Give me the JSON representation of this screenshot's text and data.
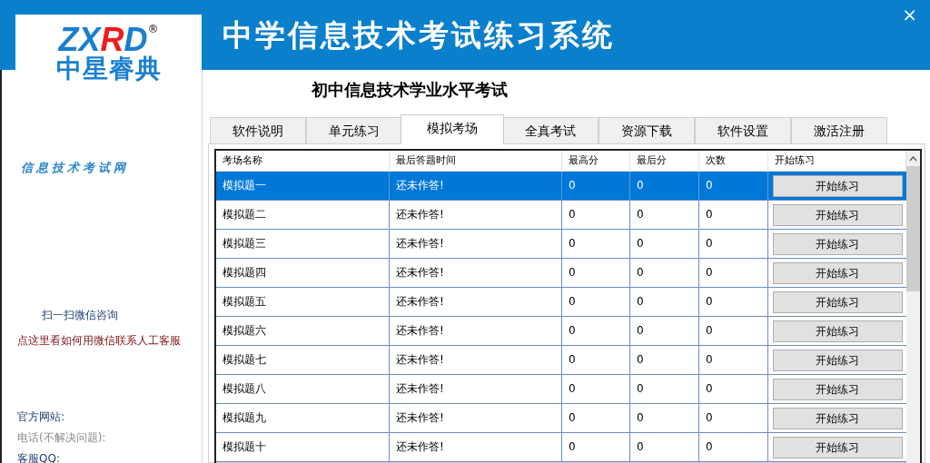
{
  "window": {
    "title": "中学信息技术考试练习系统",
    "close": "×"
  },
  "logo": {
    "letters": [
      {
        "text": "ZX",
        "color": "#1a7fcf"
      },
      {
        "text": "R",
        "color": "#f01c1c"
      },
      {
        "text": "D",
        "color": "#1a7fcf"
      }
    ],
    "mark": "®",
    "name": "中星睿典"
  },
  "sidebar": {
    "site_banner": "信息技术考试网",
    "wechat_hint": "扫一扫微信咨询",
    "wechat_link": "点这里看如何用微信联系人工客服",
    "contacts": [
      {
        "label": "官方网站:",
        "muted": false
      },
      {
        "label": "电话(不解决问题):",
        "muted": true
      },
      {
        "label": "客服QQ:",
        "muted": false
      }
    ]
  },
  "subtitle": "初中信息技术学业水平考试",
  "tabs": [
    {
      "label": "软件说明",
      "selected": false
    },
    {
      "label": "单元练习",
      "selected": false
    },
    {
      "label": "模拟考场",
      "selected": true
    },
    {
      "label": "全真考试",
      "selected": false
    },
    {
      "label": "资源下载",
      "selected": false
    },
    {
      "label": "软件设置",
      "selected": false
    },
    {
      "label": "激活注册",
      "selected": false
    }
  ],
  "table": {
    "columns": [
      "考场名称",
      "最后答题时间",
      "最高分",
      "最后分",
      "次数",
      "开始练习"
    ],
    "rows": [
      {
        "name": "模拟题一",
        "last_time": "还未作答!",
        "best": "0",
        "last": "0",
        "count": "0",
        "action": "开始练习",
        "selected": true
      },
      {
        "name": "模拟题二",
        "last_time": "还未作答!",
        "best": "0",
        "last": "0",
        "count": "0",
        "action": "开始练习",
        "selected": false
      },
      {
        "name": "模拟题三",
        "last_time": "还未作答!",
        "best": "0",
        "last": "0",
        "count": "0",
        "action": "开始练习",
        "selected": false
      },
      {
        "name": "模拟题四",
        "last_time": "还未作答!",
        "best": "0",
        "last": "0",
        "count": "0",
        "action": "开始练习",
        "selected": false
      },
      {
        "name": "模拟题五",
        "last_time": "还未作答!",
        "best": "0",
        "last": "0",
        "count": "0",
        "action": "开始练习",
        "selected": false
      },
      {
        "name": "模拟题六",
        "last_time": "还未作答!",
        "best": "0",
        "last": "0",
        "count": "0",
        "action": "开始练习",
        "selected": false
      },
      {
        "name": "模拟题七",
        "last_time": "还未作答!",
        "best": "0",
        "last": "0",
        "count": "0",
        "action": "开始练习",
        "selected": false
      },
      {
        "name": "模拟题八",
        "last_time": "还未作答!",
        "best": "0",
        "last": "0",
        "count": "0",
        "action": "开始练习",
        "selected": false
      },
      {
        "name": "模拟题九",
        "last_time": "还未作答!",
        "best": "0",
        "last": "0",
        "count": "0",
        "action": "开始练习",
        "selected": false
      },
      {
        "name": "模拟题十",
        "last_time": "还未作答!",
        "best": "0",
        "last": "0",
        "count": "0",
        "action": "开始练习",
        "selected": false
      }
    ]
  }
}
